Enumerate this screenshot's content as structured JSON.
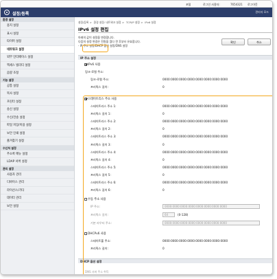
{
  "top_bar": {
    "portal": "포털",
    "login_user_label": "로그인 사용자:",
    "login_user_name": "7654321",
    "logout": "로그아웃"
  },
  "header": {
    "app_title": "설정/등록",
    "admin_mode": "관리자 모드"
  },
  "sidebar": {
    "sections": [
      {
        "title": "환경 설정",
        "items": [
          "용지 설정",
          "표시 설정",
          "타이머 설정",
          "네트워크 설정",
          "외부 인터페이스 설정",
          "액세스 빌리티 설정",
          "음량 조정"
        ]
      },
      {
        "title": "기능 설정",
        "items": [
          "공통 설정",
          "복사 설정",
          "프린터 설정",
          "송신 설정",
          "수신/전송 설정",
          "파일 저장/이용 설정",
          "보안 인쇄 설정",
          "즐겨찾기 설정"
        ]
      },
      {
        "title": "수신처 설정",
        "items": [
          "주소록 메뉴 설정",
          "LDAP 서버 설정"
        ]
      },
      {
        "title": "관리 설정",
        "items": [
          "사용자 관리",
          "디바이스 관리",
          "라이선스/기타",
          "데이터 관리",
          "보안 설정"
        ]
      }
    ],
    "active_item": "네트워크 설정"
  },
  "breadcrumb": [
    "설정/등록",
    "환경 설정: 네트워크 설정",
    "TCP/IP 설정",
    "IPv6 설정"
  ],
  "page_title": "IPv6 설정 편집",
  "description": [
    "아래의 값이 설정을 변경합니다.",
    "다음의 설정 변경은 전원을 껐다 켠 후부터 유효합니다.",
    "- IP 주소 설정/DHCP 옵션 설정/DNS 설정"
  ],
  "buttons": {
    "ok": "확인",
    "cancel": "취소"
  },
  "ip_section": {
    "title": "IP 주소 설정",
    "use_ipv6": {
      "label": "IPv6 사용",
      "checked": true
    },
    "link_local_heading": "링크-로컬 주소:",
    "link_local_address_label": "링크-로컬 주소:",
    "link_local_address": "0000:0000:0000:0000:0000:0000:0000:0000",
    "link_local_prefix_label": "프리픽스 길이:",
    "link_local_prefix": "0",
    "stateless": {
      "label": "스테이트리스 주소 사용",
      "checked": true,
      "rows": [
        {
          "label": "스테이트리스 주소 1:",
          "value": "0000:0000:0000:0000:0000:0000:0000:0000"
        },
        {
          "label": "프리픽스 길이 1:",
          "value": "0"
        },
        {
          "label": "스테이트리스 주소 2:",
          "value": "0000:0000:0000:0000:0000:0000:0000:0000"
        },
        {
          "label": "프리픽스 길이 2:",
          "value": "0"
        },
        {
          "label": "스테이트리스 주소 3:",
          "value": "0000:0000:0000:0000:0000:0000:0000:0000"
        },
        {
          "label": "프리픽스 길이 3:",
          "value": "0"
        },
        {
          "label": "스테이트리스 주소 4:",
          "value": "0000:0000:0000:0000:0000:0000:0000:0000"
        },
        {
          "label": "프리픽스 길이 4:",
          "value": "0"
        },
        {
          "label": "스테이트리스 주소 5:",
          "value": "0000:0000:0000:0000:0000:0000:0000:0000"
        },
        {
          "label": "프리픽스 길이 5:",
          "value": "0"
        },
        {
          "label": "스테이트리스 주소 6:",
          "value": "0000:0000:0000:0000:0000:0000:0000:0000"
        },
        {
          "label": "프리픽스 길이 6:",
          "value": "0"
        }
      ]
    },
    "manual": {
      "label": "수동 주소 사용",
      "checked": false,
      "ip_label": "IP 주소:",
      "ip_value": "0000:0000:0000:0000:0000:0000:0000:0000",
      "prefix_label": "프리픽스 길이:",
      "prefix_value": "64",
      "prefix_range": "(0-128)",
      "gateway_label": "기본 라우터 주소:",
      "gateway_value": "0000:0000:0000:0000:0000:0000:0000:0000"
    },
    "dhcpv6": {
      "label": "DHCPv6 사용",
      "checked": false,
      "stateful_label": "스테이트풀 주소:",
      "stateful_value": "0000:0000:0000:0000:0000:0000:0000:0000",
      "prefix_label": "프리픽스 길이:",
      "prefix_value": "0"
    }
  },
  "dhcp_section": {
    "title": "DHCP 옵션 설정",
    "first_line": "DNS 서버 주소 취득"
  },
  "colors": {
    "header_bg": "#2c3e6b",
    "callout": "#f4a81d",
    "sidebar_bg": "#eef0f3"
  }
}
